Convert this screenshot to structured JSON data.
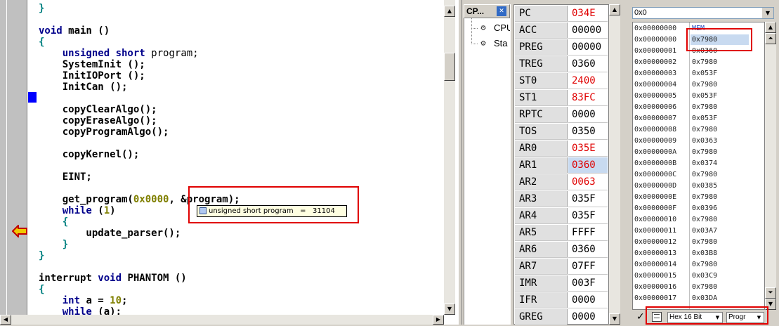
{
  "editor": {
    "tooltip": "unsigned short program   =   31104"
  },
  "tree": {
    "header": "CP...",
    "close_icon": "close-icon",
    "items": [
      {
        "label": "CPU",
        "icon": "register-icon"
      },
      {
        "label": "Sta",
        "icon": "register-icon"
      }
    ]
  },
  "registers": [
    {
      "name": "PC",
      "value": "034E",
      "changed": true
    },
    {
      "name": "ACC",
      "value": "00000",
      "changed": false
    },
    {
      "name": "PREG",
      "value": "00000",
      "changed": false
    },
    {
      "name": "TREG",
      "value": "0360",
      "changed": false
    },
    {
      "name": "ST0",
      "value": "2400",
      "changed": true
    },
    {
      "name": "ST1",
      "value": "83FC",
      "changed": true
    },
    {
      "name": "RPTC",
      "value": "0000",
      "changed": false
    },
    {
      "name": "TOS",
      "value": "0350",
      "changed": false
    },
    {
      "name": "AR0",
      "value": "035E",
      "changed": true
    },
    {
      "name": "AR1",
      "value": "0360",
      "changed": true
    },
    {
      "name": "AR2",
      "value": "0063",
      "changed": true
    },
    {
      "name": "AR3",
      "value": "035F",
      "changed": false
    },
    {
      "name": "AR4",
      "value": "035F",
      "changed": false
    },
    {
      "name": "AR5",
      "value": "FFFF",
      "changed": false
    },
    {
      "name": "AR6",
      "value": "0360",
      "changed": false
    },
    {
      "name": "AR7",
      "value": "07FF",
      "changed": false
    },
    {
      "name": "IMR",
      "value": "003F",
      "changed": false
    },
    {
      "name": "IFR",
      "value": "0000",
      "changed": false
    },
    {
      "name": "GREG",
      "value": "0000",
      "changed": false
    }
  ],
  "memory": {
    "address": "0x0",
    "rows": [
      {
        "addr": "0x00000000",
        "val": "MEM"
      },
      {
        "addr": "0x00000000",
        "val": "0x7980"
      },
      {
        "addr": "0x00000001",
        "val": "0x0360"
      },
      {
        "addr": "0x00000002",
        "val": "0x7980"
      },
      {
        "addr": "0x00000003",
        "val": "0x053F"
      },
      {
        "addr": "0x00000004",
        "val": "0x7980"
      },
      {
        "addr": "0x00000005",
        "val": "0x053F"
      },
      {
        "addr": "0x00000006",
        "val": "0x7980"
      },
      {
        "addr": "0x00000007",
        "val": "0x053F"
      },
      {
        "addr": "0x00000008",
        "val": "0x7980"
      },
      {
        "addr": "0x00000009",
        "val": "0x0363"
      },
      {
        "addr": "0x0000000A",
        "val": "0x7980"
      },
      {
        "addr": "0x0000000B",
        "val": "0x0374"
      },
      {
        "addr": "0x0000000C",
        "val": "0x7980"
      },
      {
        "addr": "0x0000000D",
        "val": "0x0385"
      },
      {
        "addr": "0x0000000E",
        "val": "0x7980"
      },
      {
        "addr": "0x0000000F",
        "val": "0x0396"
      },
      {
        "addr": "0x00000010",
        "val": "0x7980"
      },
      {
        "addr": "0x00000011",
        "val": "0x03A7"
      },
      {
        "addr": "0x00000012",
        "val": "0x7980"
      },
      {
        "addr": "0x00000013",
        "val": "0x03B8"
      },
      {
        "addr": "0x00000014",
        "val": "0x7980"
      },
      {
        "addr": "0x00000015",
        "val": "0x03C9"
      },
      {
        "addr": "0x00000016",
        "val": "0x7980"
      },
      {
        "addr": "0x00000017",
        "val": "0x03DA"
      }
    ],
    "format": "Hex 16 Bit",
    "page": "Progr"
  },
  "colors": {
    "changed": "#e00000",
    "keyword": "#00008b",
    "highlight_box": "#e00000"
  }
}
